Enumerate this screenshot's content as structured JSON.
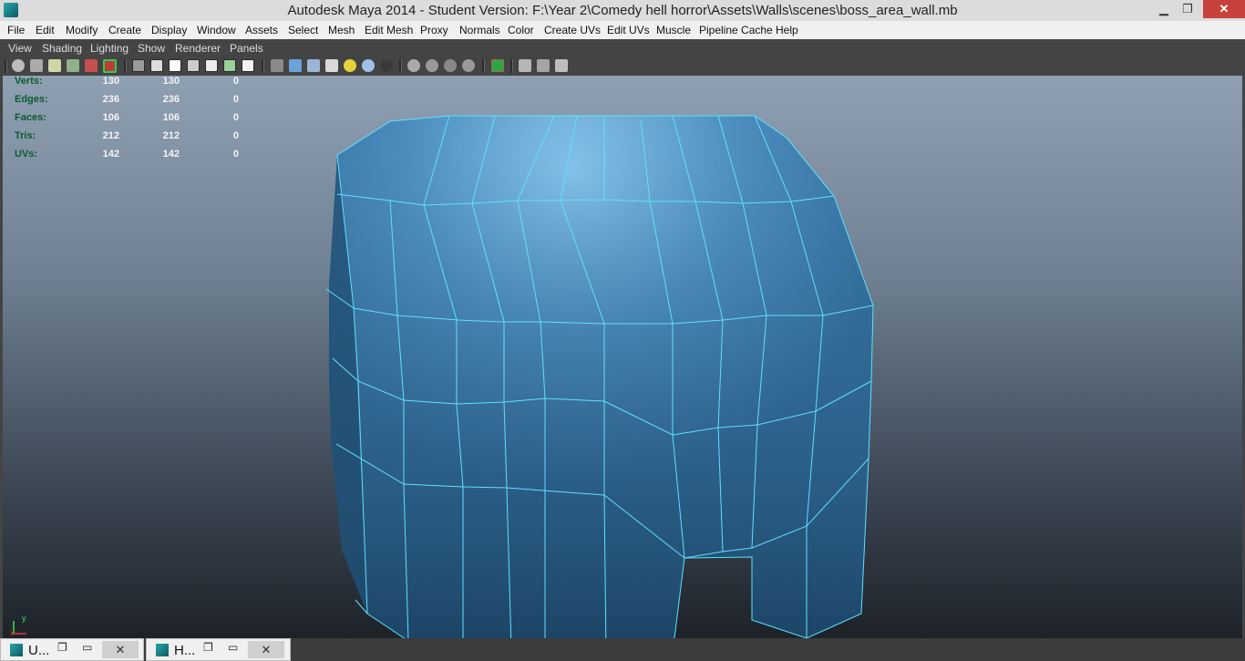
{
  "window": {
    "title": "Autodesk Maya 2014 - Student Version: F:\\Year 2\\Comedy hell horror\\Assets\\Walls\\scenes\\boss_area_wall.mb",
    "minimize": "▁",
    "maximize": "❐",
    "close": "✕"
  },
  "menubar": [
    "File",
    "Edit",
    "Modify",
    "Create",
    "Display",
    "Window",
    "Assets",
    "Select",
    "Mesh",
    "Edit Mesh",
    "Proxy",
    "Normals",
    "Color",
    "Create UVs",
    "Edit UVs",
    "Muscle",
    "Pipeline Cache",
    "Help"
  ],
  "panel_menu": [
    "View",
    "Shading",
    "Lighting",
    "Show",
    "Renderer",
    "Panels"
  ],
  "hud": [
    {
      "label": "Verts:",
      "v1": "130",
      "v2": "130",
      "v3": "0"
    },
    {
      "label": "Edges:",
      "v1": "236",
      "v2": "236",
      "v3": "0"
    },
    {
      "label": "Faces:",
      "v1": "106",
      "v2": "106",
      "v3": "0"
    },
    {
      "label": "Tris:",
      "v1": "212",
      "v2": "212",
      "v3": "0"
    },
    {
      "label": "UVs:",
      "v1": "142",
      "v2": "142",
      "v3": "0"
    }
  ],
  "viewport": {
    "camera": "persp",
    "axis_y": "y",
    "axis_x": "x",
    "wire_color": "#5fe0ff",
    "mesh_color": "#3f7fae"
  },
  "taskbar": [
    {
      "title": "U...",
      "restore": "❐",
      "max": "▭",
      "close": "✕"
    },
    {
      "title": "H...",
      "restore": "❐",
      "max": "▭",
      "close": "✕"
    }
  ]
}
